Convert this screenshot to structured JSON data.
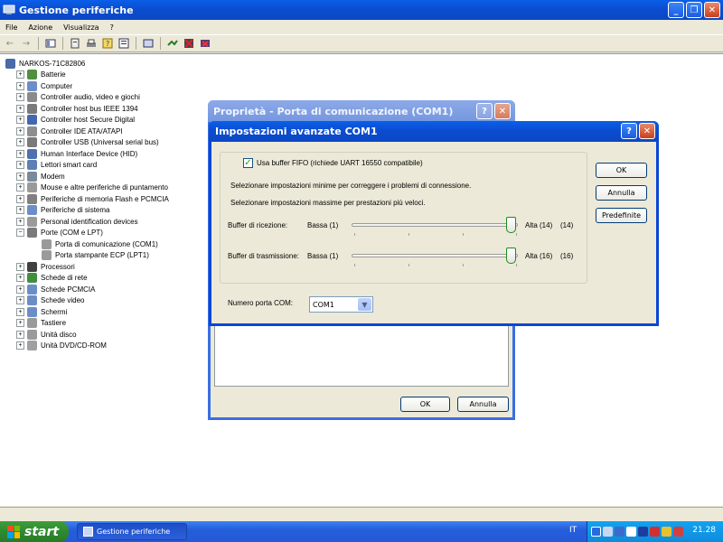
{
  "window": {
    "title": "Gestione periferiche",
    "min_glyph": "_",
    "max_glyph": "❐",
    "close_glyph": "✕"
  },
  "menu": [
    "File",
    "Azione",
    "Visualizza",
    "?"
  ],
  "toolbar_icons": [
    "back-icon",
    "forward-icon",
    "view-icon",
    "properties-icon",
    "print-icon",
    "help-icon",
    "view-list-icon",
    "scan-icon",
    "update-driver-icon",
    "disable-icon",
    "uninstall-icon"
  ],
  "tree": {
    "root": "NARKOS-71C82806",
    "items": [
      {
        "label": "Batterie",
        "expander": "+",
        "icon_color": "#4F8F3F"
      },
      {
        "label": "Computer",
        "expander": "+",
        "icon_color": "#6C8EC8"
      },
      {
        "label": "Controller audio, video e giochi",
        "expander": "+",
        "icon_color": "#8A8A8A"
      },
      {
        "label": "Controller host bus IEEE 1394",
        "expander": "+",
        "icon_color": "#7A7A7A"
      },
      {
        "label": "Controller host Secure Digital",
        "expander": "+",
        "icon_color": "#4468B0"
      },
      {
        "label": "Controller IDE ATA/ATAPI",
        "expander": "+",
        "icon_color": "#8E8E8E"
      },
      {
        "label": "Controller USB (Universal serial bus)",
        "expander": "+",
        "icon_color": "#7A7A7A"
      },
      {
        "label": "Human Interface Device (HID)",
        "expander": "+",
        "icon_color": "#4E6FB0"
      },
      {
        "label": "Lettori smart card",
        "expander": "+",
        "icon_color": "#5D7FB6"
      },
      {
        "label": "Modem",
        "expander": "+",
        "icon_color": "#7A8A9A"
      },
      {
        "label": "Mouse e altre periferiche di puntamento",
        "expander": "+",
        "icon_color": "#9A9A9A"
      },
      {
        "label": "Periferiche di memoria Flash e PCMCIA",
        "expander": "+",
        "icon_color": "#808080"
      },
      {
        "label": "Periferiche di sistema",
        "expander": "+",
        "icon_color": "#6C8EC8"
      },
      {
        "label": "Personal identification devices",
        "expander": "+",
        "icon_color": "#9A9A9A"
      },
      {
        "label": "Porte (COM e LPT)",
        "expander": "−",
        "icon_color": "#7A7A7A"
      }
    ],
    "ports_children": [
      "Porta di comunicazione (COM1)",
      "Porta stampante ECP (LPT1)"
    ],
    "items_after": [
      {
        "label": "Processori",
        "expander": "+",
        "icon_color": "#404040"
      },
      {
        "label": "Schede di rete",
        "expander": "+",
        "icon_color": "#3F8F3F"
      },
      {
        "label": "Schede PCMCIA",
        "expander": "+",
        "icon_color": "#6C8EC8"
      },
      {
        "label": "Schede video",
        "expander": "+",
        "icon_color": "#6C8EC8"
      },
      {
        "label": "Schermi",
        "expander": "+",
        "icon_color": "#6C8EC8"
      },
      {
        "label": "Tastiere",
        "expander": "+",
        "icon_color": "#9A9A9A"
      },
      {
        "label": "Unità disco",
        "expander": "+",
        "icon_color": "#9A9A9A"
      },
      {
        "label": "Unità DVD/CD-ROM",
        "expander": "+",
        "icon_color": "#A0A0A0"
      }
    ]
  },
  "props_dialog": {
    "title": "Proprietà - Porta di comunicazione (COM1)",
    "ok": "OK",
    "cancel": "Annulla",
    "help_glyph": "?",
    "close_glyph": "✕"
  },
  "adv_dialog": {
    "title": "Impostazioni avanzate COM1",
    "help_glyph": "?",
    "close_glyph": "✕",
    "fifo_label": "Usa buffer FIFO (richiede UART 16550 compatibile)",
    "fifo_checked": true,
    "hint_min": "Selezionare impostazioni minime per correggere i problemi di connessione.",
    "hint_max": "Selezionare impostazioni massime per prestazioni più veloci.",
    "rx": {
      "label": "Buffer di ricezione:",
      "low": "Bassa (1)",
      "high": "Alta (14)",
      "value": "(14)",
      "level": 1.0
    },
    "tx": {
      "label": "Buffer di trasmissione:",
      "low": "Bassa (1)",
      "high": "Alta (16)",
      "value": "(16)",
      "level": 1.0
    },
    "com_label": "Numero porta COM:",
    "com_value": "COM1",
    "ok": "OK",
    "cancel": "Annulla",
    "defaults": "Predefinite"
  },
  "taskbar": {
    "start": "start",
    "task": "Gestione periferiche",
    "lang": "IT",
    "clock": "21.28"
  },
  "colors": {
    "xp_blue": "#0A46D6",
    "start_green": "#2F8A2F",
    "check_green": "#21A121"
  }
}
